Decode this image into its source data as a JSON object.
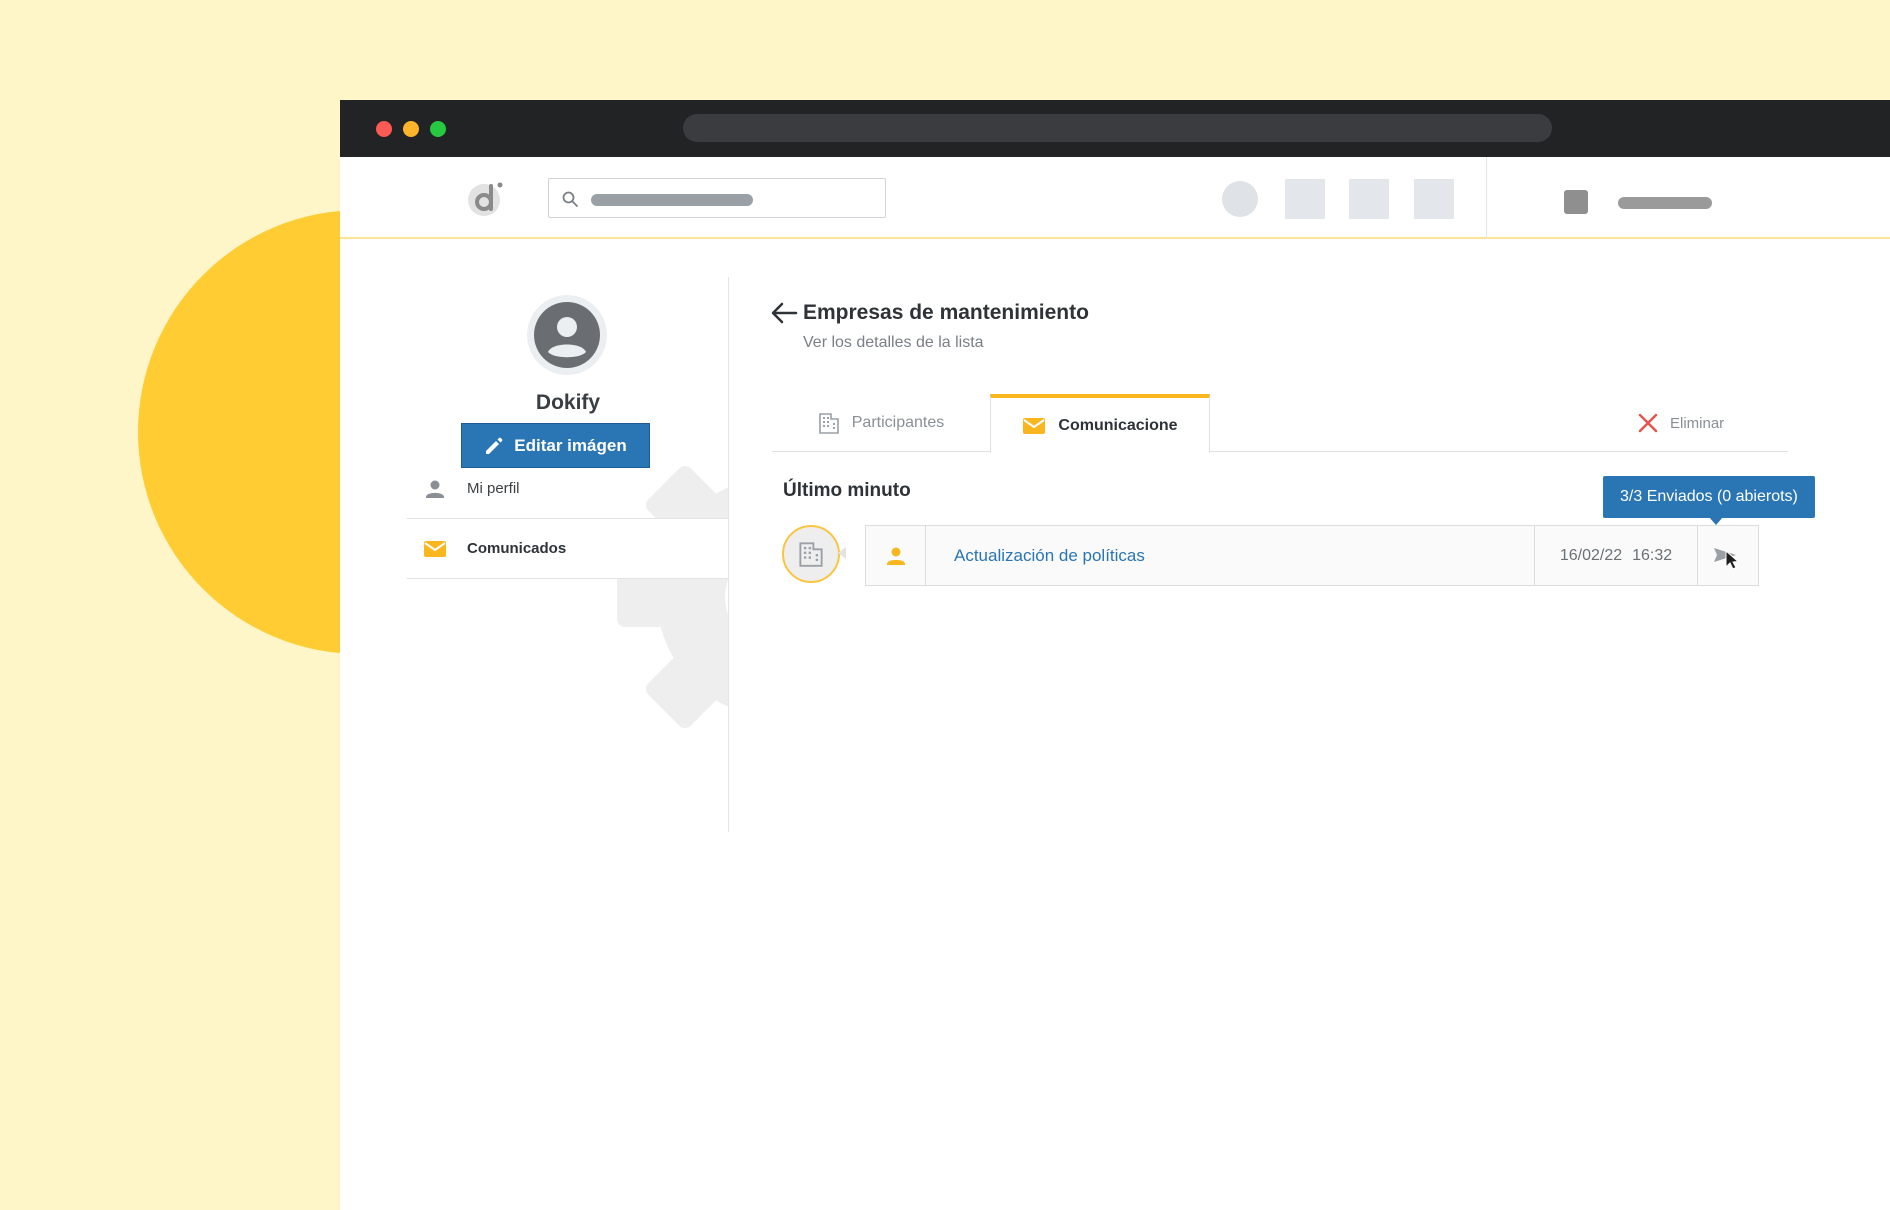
{
  "colors": {
    "accent": "#2a75b3",
    "highlight": "#f9b61f",
    "background": "#fef6c9",
    "blob": "#ffcd33",
    "danger": "#e5534b"
  },
  "profile": {
    "name": "Dokify",
    "edit_button": "Editar imágen"
  },
  "sidebar": {
    "items": [
      {
        "label": "Mi perfil",
        "icon": "person-icon"
      },
      {
        "label": "Comunicados",
        "icon": "mail-icon"
      }
    ]
  },
  "page": {
    "title": "Empresas de mantenimiento",
    "subtitle": "Ver los detalles de la lista"
  },
  "tabs": [
    {
      "label": "Participantes",
      "icon": "building-icon",
      "active": false
    },
    {
      "label": "Comunicacione",
      "icon": "mail-icon",
      "active": true
    }
  ],
  "actions": {
    "delete_label": "Eliminar"
  },
  "section": {
    "title": "Último minuto"
  },
  "communication": {
    "title": "Actualización de políticas",
    "date": "16/02/22",
    "time": "16:32",
    "tooltip": "3/3 Enviados (0 abierots)"
  }
}
